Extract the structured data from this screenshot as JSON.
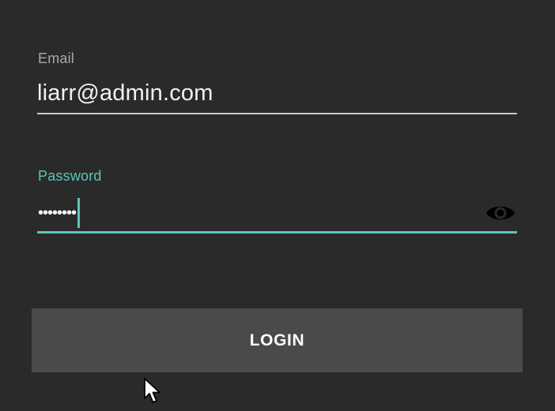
{
  "form": {
    "email": {
      "label": "Email",
      "value": "liarr@admin.com"
    },
    "password": {
      "label": "Password",
      "masked_value": "••••••••",
      "toggle_icon": "eye-icon",
      "focused": true
    },
    "login_button": {
      "label": "LOGIN"
    }
  },
  "theme": {
    "background": "#2a2a2a",
    "accent": "#5cc6b9",
    "button_background": "#4a4a4a",
    "text_primary": "#f2f2f2",
    "text_secondary": "#a9a9a9"
  }
}
